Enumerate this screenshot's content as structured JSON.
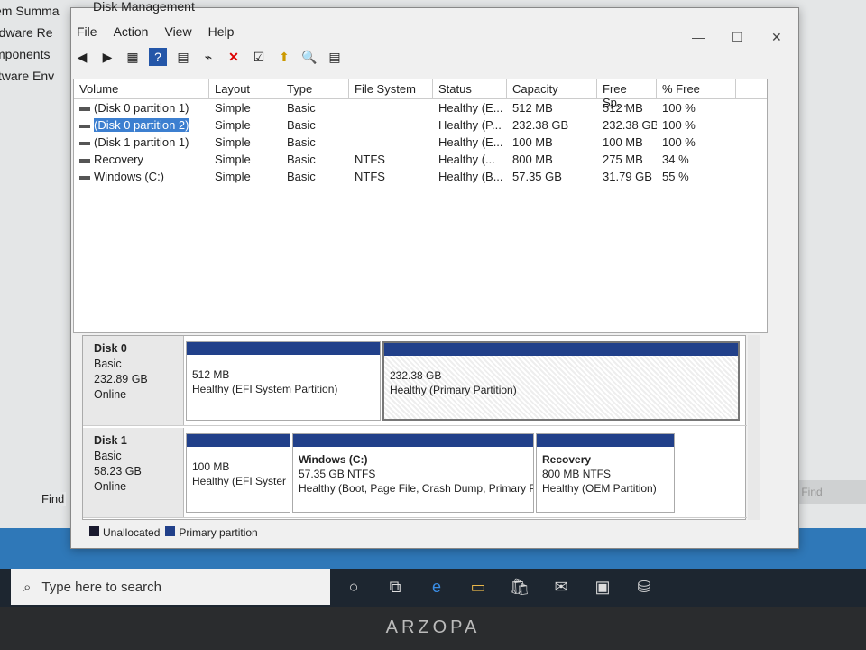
{
  "background": {
    "sidebar": [
      "em Summa",
      "rdware Re",
      "mponents",
      "ftware Env"
    ],
    "find_label": "Find",
    "find_button": "Find"
  },
  "window": {
    "title": "Disk Management",
    "menu": [
      "File",
      "Action",
      "View",
      "Help"
    ],
    "columns": [
      "Volume",
      "Layout",
      "Type",
      "File System",
      "Status",
      "Capacity",
      "Free Sp...",
      "% Free"
    ],
    "rows": [
      {
        "volume": "(Disk 0 partition 1)",
        "layout": "Simple",
        "type": "Basic",
        "fs": "",
        "status": "Healthy (E...",
        "capacity": "512 MB",
        "free": "512 MB",
        "pct": "100 %",
        "selected": false
      },
      {
        "volume": "(Disk 0 partition 2)",
        "layout": "Simple",
        "type": "Basic",
        "fs": "",
        "status": "Healthy (P...",
        "capacity": "232.38 GB",
        "free": "232.38 GB",
        "pct": "100 %",
        "selected": true
      },
      {
        "volume": "(Disk 1 partition 1)",
        "layout": "Simple",
        "type": "Basic",
        "fs": "",
        "status": "Healthy (E...",
        "capacity": "100 MB",
        "free": "100 MB",
        "pct": "100 %",
        "selected": false
      },
      {
        "volume": "Recovery",
        "layout": "Simple",
        "type": "Basic",
        "fs": "NTFS",
        "status": "Healthy (...",
        "capacity": "800 MB",
        "free": "275 MB",
        "pct": "34 %",
        "selected": false
      },
      {
        "volume": "Windows (C:)",
        "layout": "Simple",
        "type": "Basic",
        "fs": "NTFS",
        "status": "Healthy (B...",
        "capacity": "57.35 GB",
        "free": "31.79 GB",
        "pct": "55 %",
        "selected": false
      }
    ],
    "disks": [
      {
        "name": "Disk 0",
        "type": "Basic",
        "size": "232.89 GB",
        "state": "Online",
        "partitions": [
          {
            "name": "",
            "size": "512 MB",
            "status": "Healthy (EFI System Partition)"
          },
          {
            "name": "",
            "size": "232.38 GB",
            "status": "Healthy (Primary Partition)"
          }
        ]
      },
      {
        "name": "Disk 1",
        "type": "Basic",
        "size": "58.23 GB",
        "state": "Online",
        "partitions": [
          {
            "name": "",
            "size": "100 MB",
            "status": "Healthy (EFI Syster"
          },
          {
            "name": "Windows  (C:)",
            "size": "57.35 GB NTFS",
            "status": "Healthy (Boot, Page File, Crash Dump, Primary P"
          },
          {
            "name": "Recovery",
            "size": "800 MB NTFS",
            "status": "Healthy (OEM Partition)"
          }
        ]
      }
    ],
    "legend": [
      {
        "label": "Unallocated",
        "color": "#1a1a2e"
      },
      {
        "label": "Primary partition",
        "color": "#21408a"
      }
    ]
  },
  "taskbar": {
    "search_placeholder": "Type here to search"
  },
  "bezel_brand": "ARZOPA"
}
